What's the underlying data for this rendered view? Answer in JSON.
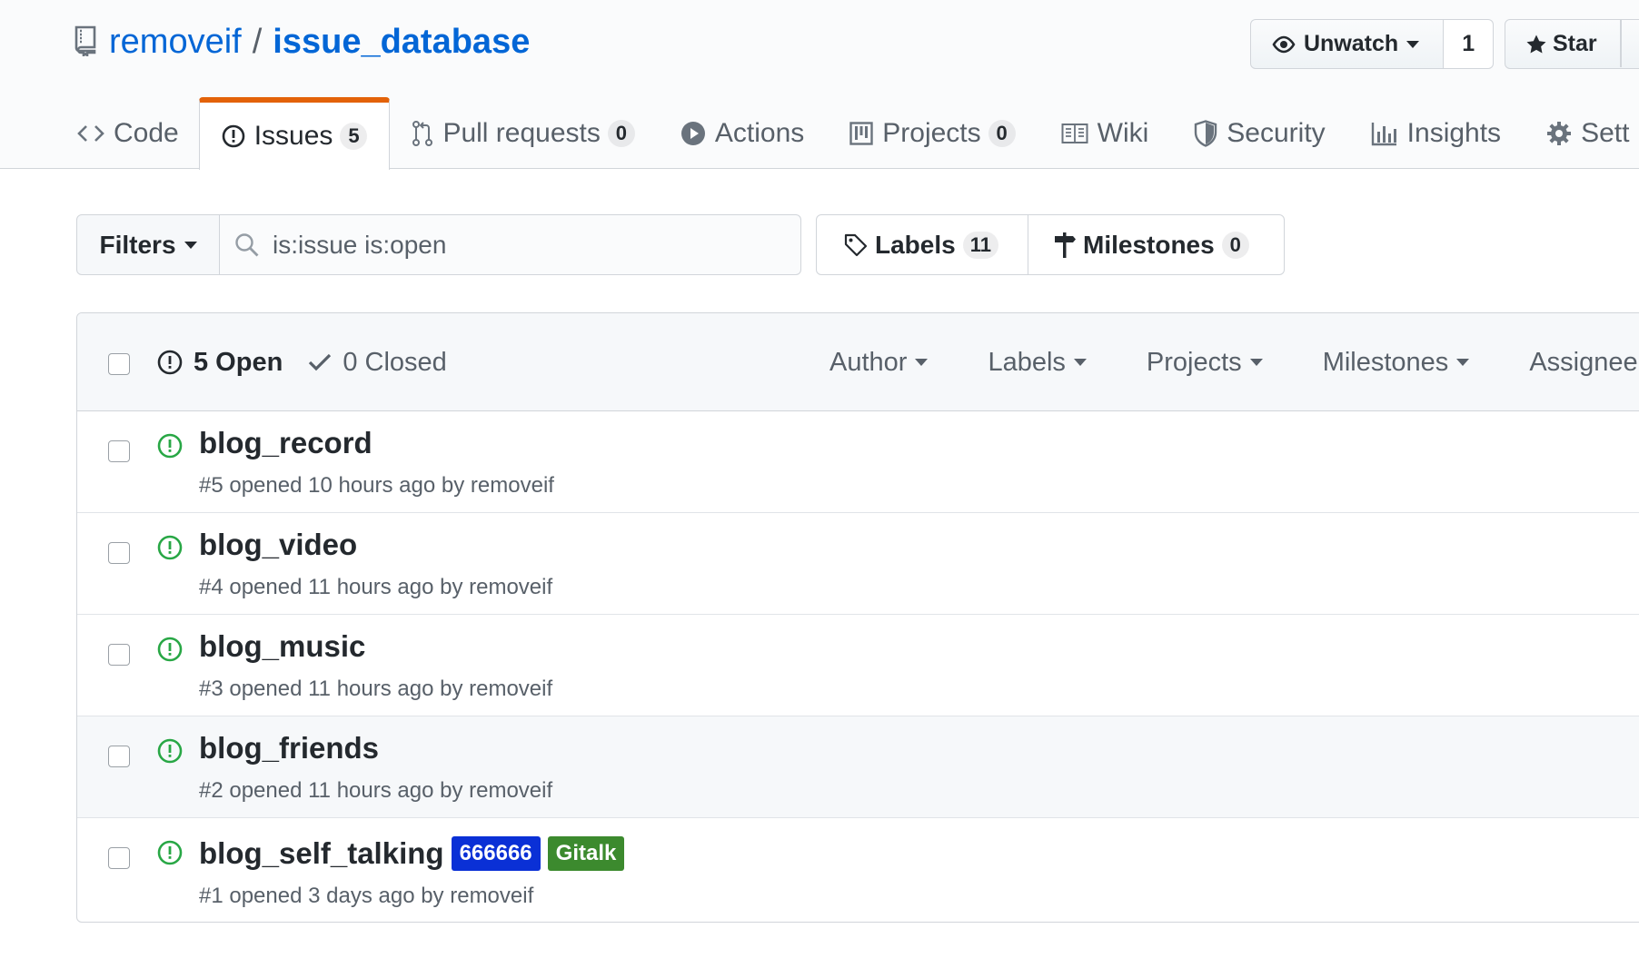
{
  "repo": {
    "owner": "removeif",
    "separator": "/",
    "name": "issue_database"
  },
  "actions": {
    "unwatch_label": "Unwatch",
    "watch_count": "1",
    "star_label": "Star"
  },
  "tabs": [
    {
      "label": "Code",
      "icon": "code-icon"
    },
    {
      "label": "Issues",
      "count": "5",
      "icon": "issue-opened-icon",
      "selected": true
    },
    {
      "label": "Pull requests",
      "count": "0",
      "icon": "git-pull-request-icon"
    },
    {
      "label": "Actions",
      "icon": "play-icon"
    },
    {
      "label": "Projects",
      "count": "0",
      "icon": "project-icon"
    },
    {
      "label": "Wiki",
      "icon": "book-icon"
    },
    {
      "label": "Security",
      "icon": "shield-icon"
    },
    {
      "label": "Insights",
      "icon": "graph-icon"
    },
    {
      "label": "Sett",
      "icon": "gear-icon"
    }
  ],
  "subnav": {
    "filters_label": "Filters",
    "search_value": "is:issue is:open",
    "labels_label": "Labels",
    "labels_count": "11",
    "milestones_label": "Milestones",
    "milestones_count": "0"
  },
  "issues_header": {
    "open_label": "5 Open",
    "closed_label": "0 Closed",
    "sort_menus": [
      "Author",
      "Labels",
      "Projects",
      "Milestones",
      "Assignee"
    ]
  },
  "issues": [
    {
      "title": "blog_record",
      "meta": "#5 opened 10 hours ago by removeif",
      "labels": []
    },
    {
      "title": "blog_video",
      "meta": "#4 opened 11 hours ago by removeif",
      "labels": []
    },
    {
      "title": "blog_music",
      "meta": "#3 opened 11 hours ago by removeif",
      "labels": []
    },
    {
      "title": "blog_friends",
      "meta": "#2 opened 11 hours ago by removeif",
      "labels": []
    },
    {
      "title": "blog_self_talking",
      "meta": "#1 opened 3 days ago by removeif",
      "labels": [
        {
          "name": "666666",
          "color": "#0a30d6"
        },
        {
          "name": "Gitalk",
          "color": "#3c8a2e"
        }
      ]
    }
  ],
  "colors": {
    "link": "#0366d6",
    "open_issue": "#28a745",
    "selected_tab_accent": "#e36209"
  }
}
